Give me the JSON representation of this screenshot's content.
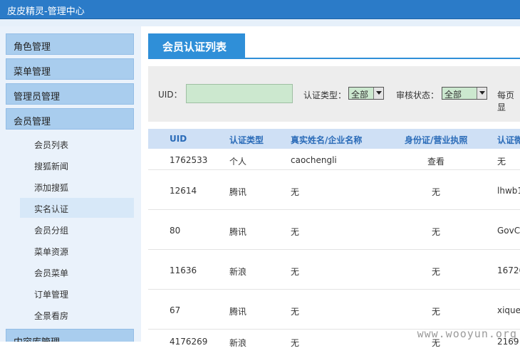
{
  "header": {
    "title": "皮皮精灵-管理中心"
  },
  "sidebar": {
    "groups": [
      {
        "label": "角色管理"
      },
      {
        "label": "菜单管理"
      },
      {
        "label": "管理员管理"
      },
      {
        "label": "会员管理"
      },
      {
        "label": "内容库管理"
      }
    ],
    "sub_items": [
      {
        "label": "会员列表"
      },
      {
        "label": "搜狐新闻"
      },
      {
        "label": "添加搜狐"
      },
      {
        "label": "实名认证"
      },
      {
        "label": "会员分组"
      },
      {
        "label": "菜单资源"
      },
      {
        "label": "会员菜单"
      },
      {
        "label": "订单管理"
      },
      {
        "label": "全景看房"
      }
    ],
    "active_sub_item": "实名认证"
  },
  "main": {
    "tab_title": "会员认证列表",
    "filter": {
      "uid_label": "UID：",
      "uid_value": "",
      "type_label": "认证类型：",
      "type_selected": "全部",
      "status_label": "审核状态：",
      "status_selected": "全部",
      "page_size_label": "每页显"
    },
    "table": {
      "columns": [
        "UID",
        "认证类型",
        "真实姓名/企业名称",
        "身份证/营业执照",
        "认证微"
      ],
      "rows": [
        {
          "uid": "1762533",
          "type": "个人",
          "name": "caochengli",
          "license": "查看",
          "extra": "无"
        },
        {
          "uid": "12614",
          "type": "腾讯",
          "name": "无",
          "license": "无",
          "extra": "lhwb1"
        },
        {
          "uid": "80",
          "type": "腾讯",
          "name": "无",
          "license": "无",
          "extra": "GovC"
        },
        {
          "uid": "11636",
          "type": "新浪",
          "name": "无",
          "license": "无",
          "extra": "16726"
        },
        {
          "uid": "67",
          "type": "腾讯",
          "name": "无",
          "license": "无",
          "extra": "xique"
        },
        {
          "uid": "4176269",
          "type": "新浪",
          "name": "无",
          "license": "无",
          "extra": "2169"
        }
      ]
    }
  },
  "watermark": "www.wooyun.org",
  "colors": {
    "topbar": "#2b7bc8",
    "tab": "#2f8fd8",
    "menu_group": "#a9cdee",
    "header_text": "#2a6bb8"
  }
}
